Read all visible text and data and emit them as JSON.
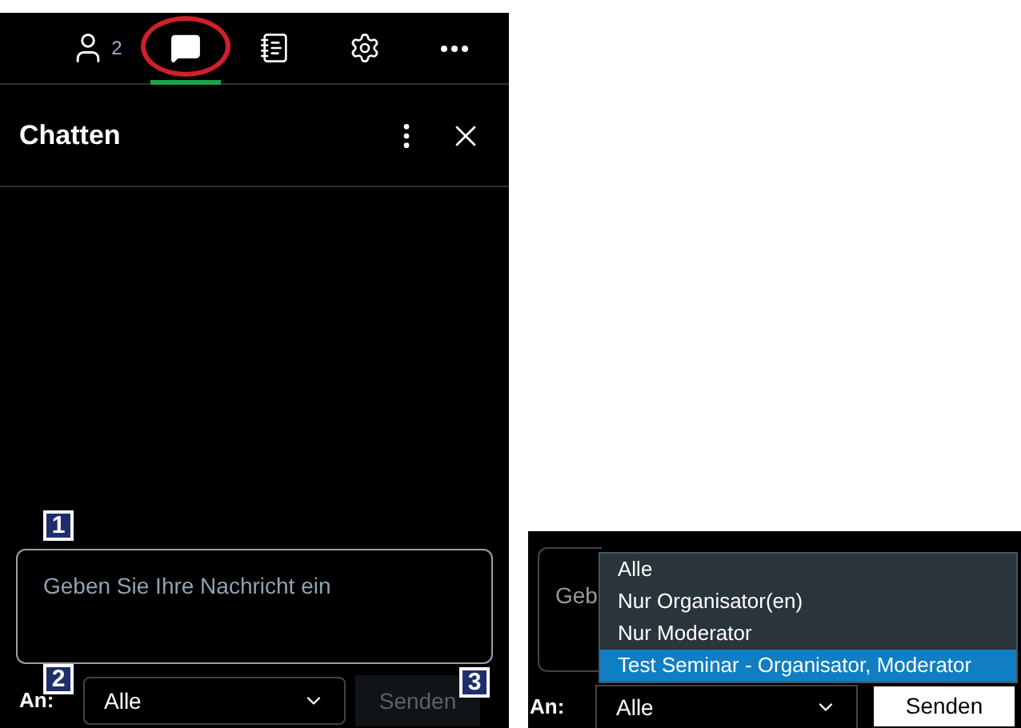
{
  "toolbar": {
    "participant_count": "2",
    "tabs": [
      {
        "kind": "people",
        "selected": false,
        "circled": false
      },
      {
        "kind": "chat",
        "selected": true,
        "circled": true
      },
      {
        "kind": "notes",
        "selected": false,
        "circled": false
      },
      {
        "kind": "settings",
        "selected": false,
        "circled": false
      },
      {
        "kind": "more",
        "selected": false,
        "circled": false
      }
    ]
  },
  "panel": {
    "title": "Chatten"
  },
  "composer": {
    "placeholder": "Geben Sie Ihre Nachricht ein",
    "to_label": "An:",
    "recipient": "Alle",
    "send_button": {
      "label": "Senden",
      "disabled": true
    }
  },
  "callouts": [
    "1",
    "2",
    "3"
  ],
  "inset": {
    "field_fragment": "Geb",
    "options": [
      {
        "label": "Alle",
        "selected": false
      },
      {
        "label": "Nur Organisator(en)",
        "selected": false
      },
      {
        "label": "Nur Moderator",
        "selected": false
      },
      {
        "label": "Test Seminar - Organisator, Moderator",
        "selected": true
      }
    ],
    "to_label": "An:",
    "recipient": "Alle",
    "send_button": {
      "label": "Senden",
      "disabled": false
    }
  }
}
